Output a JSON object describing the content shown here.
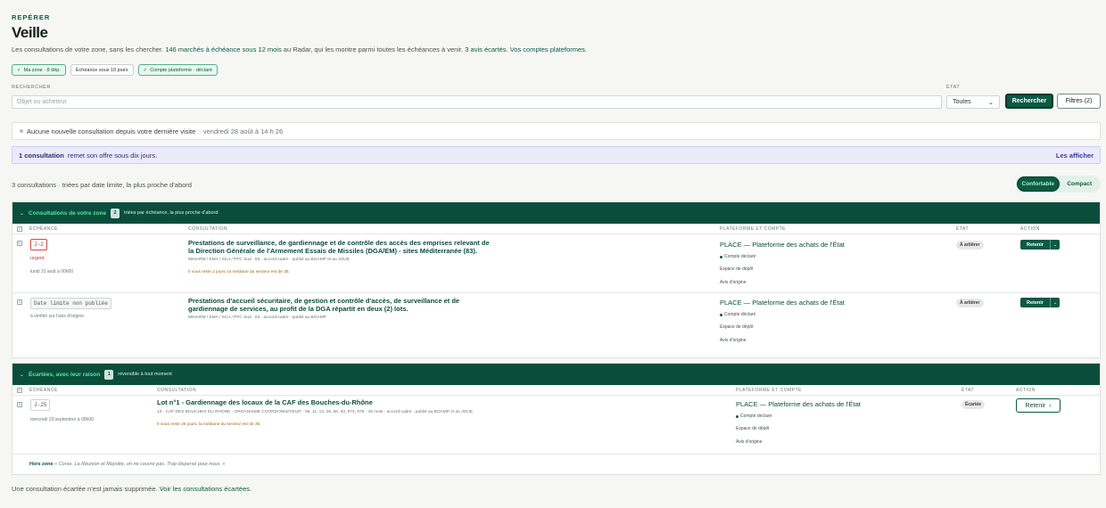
{
  "header": {
    "eyebrow": "REPÉRER",
    "title": "Veille",
    "intro_start": "Les consultations de votre zone, sans les chercher.",
    "intro_link1": "146 marchés à échéance sous 12 mois",
    "intro_mid": "au Radar, qui les montre parmi toutes les échéances à venir.",
    "intro_link2": "3 avis écartés.",
    "intro_link3": "Vos comptes plateformes."
  },
  "chips": [
    {
      "label": "Ma zone · 8 dép.",
      "active": true,
      "icon": "check-icon"
    },
    {
      "label": "Échéance sous 10 jours",
      "active": false
    },
    {
      "label": "Compte plateforme · déclaré",
      "active": true,
      "icon": "check-icon"
    }
  ],
  "search": {
    "label": "RECHERCHER",
    "placeholder": "Objet ou acheteur",
    "state_label": "ÉTAT",
    "state_value": "Toutes",
    "submit_label": "Rechercher",
    "filters_label": "Filtres (2)"
  },
  "notice": {
    "text": "Aucune nouvelle consultation depuis votre dernière visite",
    "date": "· vendredi 28 août à 14 h 26"
  },
  "banner": {
    "strong": "1 consultation",
    "text": "remet son offre sous dix jours.",
    "action": "Les afficher"
  },
  "summary": {
    "count": "3 consultations · triées par date limite, la plus proche d'abord",
    "view_options": [
      "Confortable",
      "Compact"
    ],
    "view_selected": "Confortable"
  },
  "zone_section": {
    "title": "Consultations de votre zone",
    "count": "2",
    "subtitle": "triées par échéance, la plus proche d'abord",
    "columns": [
      "ÉCHÉANCE",
      "CONSULTATION",
      "PLATEFORME ET COMPTE",
      "ÉTAT",
      "ACTION"
    ],
    "rows": [
      {
        "deadline_tag": "J-2",
        "urgency": "urgent",
        "deadline_date": "lundi 31 août à 00h00",
        "title_line1": "Prestations de surveillance, de gardiennage et de contrôle des accès des emprises relevant de",
        "title_line2": "la Direction Générale de l'Armement Essais de Missiles (DGA/EM) - sites Méditerranée (83).",
        "meta": "MINARM / EMA / SCA / PFC Sud · 83 · accord-cadre · publié au BOAMP et au JOUE",
        "note": "Il vous reste 2 jours, la médiane du secteur est de 35.",
        "platform": "PLACE — Plateforme des achats de l'État",
        "account": "Compte déclaré",
        "deposit": "Espace de dépôt",
        "origin": "Avis d'origine",
        "state": "À arbitrer",
        "action": "Retenir"
      },
      {
        "deadline_tag": "Date limite non publiée",
        "deadline_note": "à vérifier sur l'avis d'origine",
        "title_line1": "Prestations d'accueil sécuritaire, de gestion et contrôle d'accès, de surveillance et de",
        "title_line2": "gardiennage de services, au profit de la DGA répartit en deux (2) lots.",
        "meta": "MINARM / EMA / SCA / PFC Sud · 83 · accord-cadre · publié au BOAMP",
        "platform": "PLACE — Plateforme des achats de l'État",
        "account": "Compte déclaré",
        "deposit": "Espace de dépôt",
        "origin": "Avis d'origine",
        "state": "À arbitrer",
        "action": "Retenir"
      }
    ]
  },
  "discarded_section": {
    "title": "Écartées, avec leur raison",
    "count": "1",
    "subtitle": "réversible à tout moment",
    "columns": [
      "ÉCHÉANCE",
      "CONSULTATION",
      "PLATEFORME ET COMPTE",
      "ÉTAT",
      "ACTION"
    ],
    "row": {
      "deadline_tag": "J-25",
      "deadline_date": "mercredi 23 septembre à 00h00",
      "title": "Lot n°1 - Gardiennage des locaux de la CAF des Bouches-du-Rhône",
      "meta": "13 · CAF DES BOUCHES DU RHONE - ORGANISME COORDONNATEUR · 06, 11, 13, 28, 66, 83, 974, 976 · 48 mois · accord-cadre · publié au BOAMP et au JOUE",
      "note": "Il vous reste 25 jours, la médiane du secteur est de 35.",
      "platform": "PLACE — Plateforme des achats de l'État",
      "account": "Compte déclaré",
      "deposit": "Espace de dépôt",
      "origin": "Avis d'origine",
      "state": "Écartée",
      "action": "Retenir"
    },
    "reason_label": "Hors zone",
    "reason_text": "« Corse, La Réunion et Mayotte, on ne couvre pas. Trop dispersé pour nous. »"
  },
  "footer": {
    "text": "Une consultation écartée n'est jamais supprimée.",
    "link": "Voir les consultations écartées."
  },
  "colors": {
    "brand": "#0b5a44",
    "section_header": "#0b4d3b",
    "accent_green": "#58e39f",
    "urgent": "#cc3333",
    "banner_bg": "#ebeaf9"
  }
}
